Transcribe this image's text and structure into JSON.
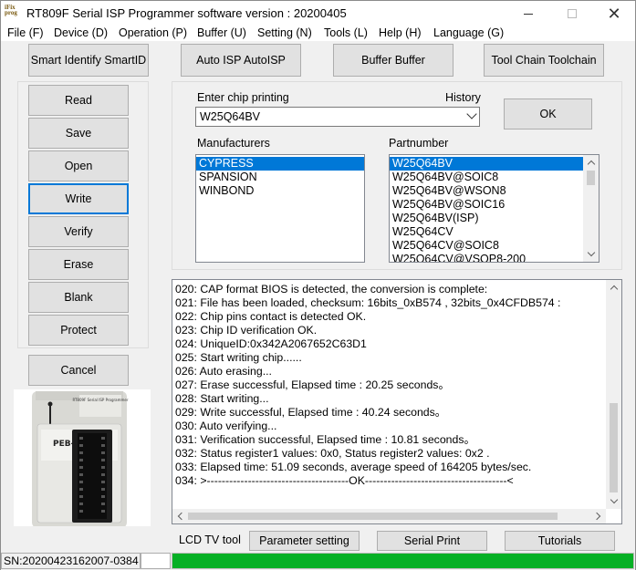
{
  "window": {
    "title": "RT809F Serial ISP Programmer software version : 20200405",
    "logo_text": [
      "iFix",
      "prog"
    ]
  },
  "menu": [
    "File (F)",
    "Device (D)",
    "Operation (P)",
    "Buffer (U)",
    "Setting (N)",
    "Tools (L)",
    "Help (H)",
    "Language (G)"
  ],
  "toolbar": {
    "smartid": "Smart Identify SmartID",
    "autoisp": "Auto ISP AutoISP",
    "buffer": "Buffer Buffer",
    "toolchain": "Tool Chain Toolchain"
  },
  "actions": {
    "read": "Read",
    "save": "Save",
    "open": "Open",
    "write": "Write",
    "verify": "Verify",
    "erase": "Erase",
    "blank": "Blank",
    "protect": "Protect",
    "cancel": "Cancel"
  },
  "chip": {
    "label": "Enter chip printing",
    "history_label": "History",
    "value": "W25Q64BV",
    "ok": "OK",
    "manufacturers_label": "Manufacturers",
    "partnumber_label": "Partnumber",
    "manufacturers": [
      {
        "name": "CYPRESS",
        "selected": true
      },
      {
        "name": "SPANSION",
        "selected": false
      },
      {
        "name": "WINBOND",
        "selected": false
      }
    ],
    "partnumbers": [
      {
        "name": "W25Q64BV",
        "selected": true
      },
      {
        "name": "W25Q64BV@SOIC8",
        "selected": false
      },
      {
        "name": "W25Q64BV@WSON8",
        "selected": false
      },
      {
        "name": "W25Q64BV@SOIC16",
        "selected": false
      },
      {
        "name": "W25Q64BV(ISP)",
        "selected": false
      },
      {
        "name": "W25Q64CV",
        "selected": false
      },
      {
        "name": "W25Q64CV@SOIC8",
        "selected": false
      },
      {
        "name": "W25Q64CV@VSOP8-200",
        "selected": false
      }
    ]
  },
  "log": [
    "020:  CAP format BIOS is detected, the conversion is complete:",
    "021:  File has been loaded, checksum: 16bits_0xB574 ,  32bits_0x4CFDB574 :",
    "022:  Chip pins contact is detected OK.",
    "023:  Chip ID verification OK.",
    "024:  UniqueID:0x342A2067652C63D1",
    "025:  Start writing chip......",
    "026:  Auto erasing...",
    "027:  Erase successful,  Elapsed time : 20.25 seconds。",
    "028:  Start writing...",
    "029:  Write successful,  Elapsed time : 40.24 seconds。",
    "030:  Auto verifying...",
    "031:  Verification successful,  Elapsed time : 10.81 seconds。",
    "032:  Status register1 values: 0x0, Status register2 values: 0x2 .",
    "033:  Elapsed time: 51.09 seconds,  average speed of 164205 bytes/sec.",
    "034:  >--------------------------------------OK--------------------------------------<"
  ],
  "device_image": {
    "brand": "RT809F Serial ISP Programmer",
    "label": "PEB-1"
  },
  "bottom": {
    "lcd_label": "LCD TV tool",
    "parameter": "Parameter setting",
    "serial_print": "Serial Print",
    "tutorials": "Tutorials"
  },
  "status": {
    "sn": "SN:20200423162007-0384",
    "progress": 1.0,
    "progress_color": "#06b025"
  }
}
